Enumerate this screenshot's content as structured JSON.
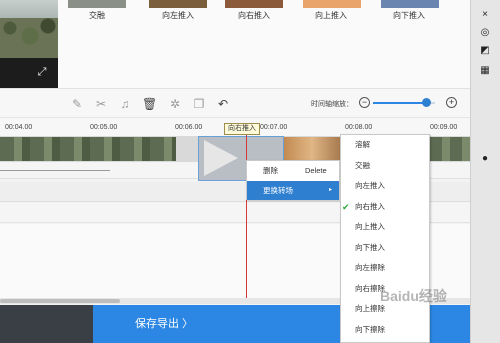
{
  "transitions": {
    "tiles": [
      {
        "label": "交融",
        "color": "#8a8f88"
      },
      {
        "label": "向左推入",
        "color": "#7b5e3c"
      },
      {
        "label": "向右推入",
        "color": "#8a5a3a"
      },
      {
        "label": "向上推入",
        "color": "#e8a46a"
      },
      {
        "label": "向下推入",
        "color": "#6a86b0"
      }
    ]
  },
  "toolbar": {
    "zoom_label": "时间轴缩放：",
    "zoom_level": 0.85
  },
  "ruler": {
    "ticks": [
      "00:04.00",
      "00:05.00",
      "00:06.00",
      "00:07.00",
      "00:08.00",
      "00:09.00"
    ]
  },
  "playhead": {
    "tooltip": "向右推入"
  },
  "context_menu": {
    "delete_label": "删除",
    "delete_shortcut": "Delete",
    "change_transition_label": "更换转场",
    "arrow": "▸"
  },
  "transition_menu": {
    "items": [
      "溶解",
      "交融",
      "向左推入",
      "向右推入",
      "向上推入",
      "向下推入",
      "向左擦除",
      "向右擦除",
      "向上擦除",
      "向下擦除"
    ],
    "checked": "向右推入"
  },
  "export": {
    "label": "保存导出 〉"
  },
  "watermark": {
    "text": "Baidu经验"
  },
  "colors": {
    "accent": "#2b87e3",
    "playhead": "#d33a3a"
  }
}
